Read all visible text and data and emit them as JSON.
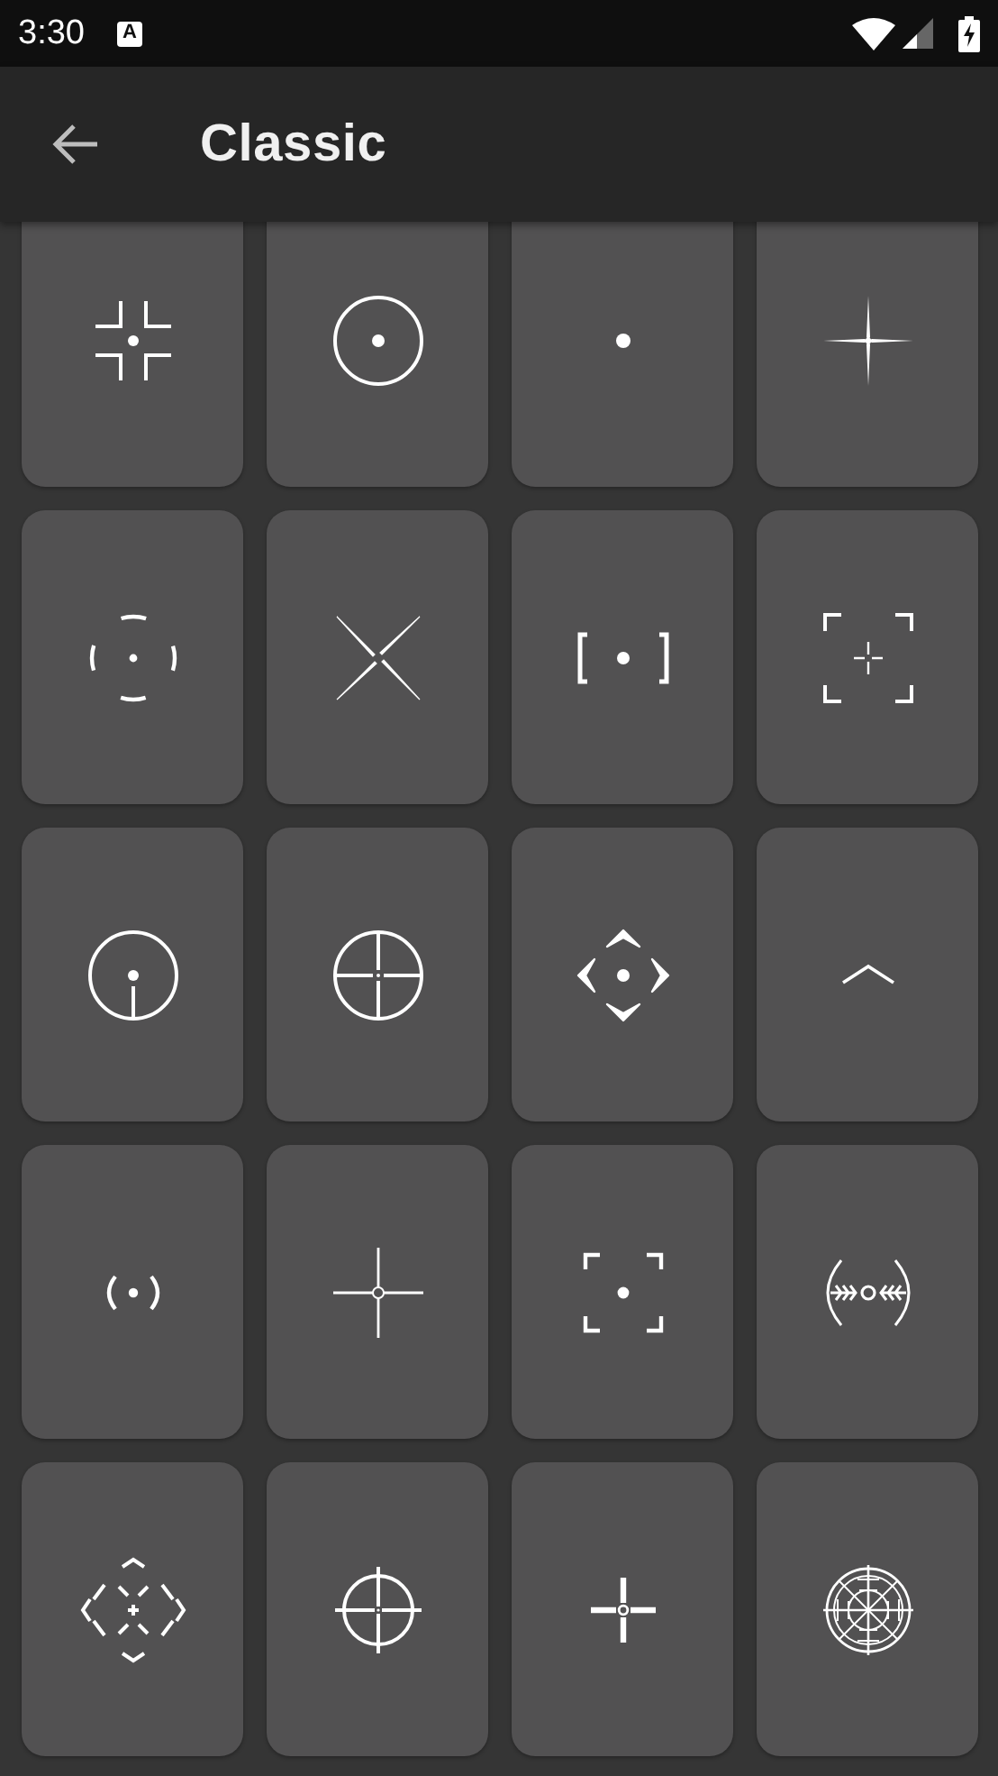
{
  "status_bar": {
    "time": "3:30",
    "notification_icon": "A"
  },
  "app_bar": {
    "title": "Classic"
  },
  "crosshairs": [
    {
      "kind": "corners"
    },
    {
      "kind": "ringdot"
    },
    {
      "kind": "dot"
    },
    {
      "kind": "star"
    },
    {
      "kind": "dashedring"
    },
    {
      "kind": "xcross"
    },
    {
      "kind": "brackets"
    },
    {
      "kind": "framecross"
    },
    {
      "kind": "ringpost"
    },
    {
      "kind": "scope"
    },
    {
      "kind": "diamond"
    },
    {
      "kind": "chevron"
    },
    {
      "kind": "parens"
    },
    {
      "kind": "finecross"
    },
    {
      "kind": "framedot"
    },
    {
      "kind": "rangefinder"
    },
    {
      "kind": "octagon"
    },
    {
      "kind": "ringcross"
    },
    {
      "kind": "thickcross"
    },
    {
      "kind": "mildot"
    }
  ]
}
